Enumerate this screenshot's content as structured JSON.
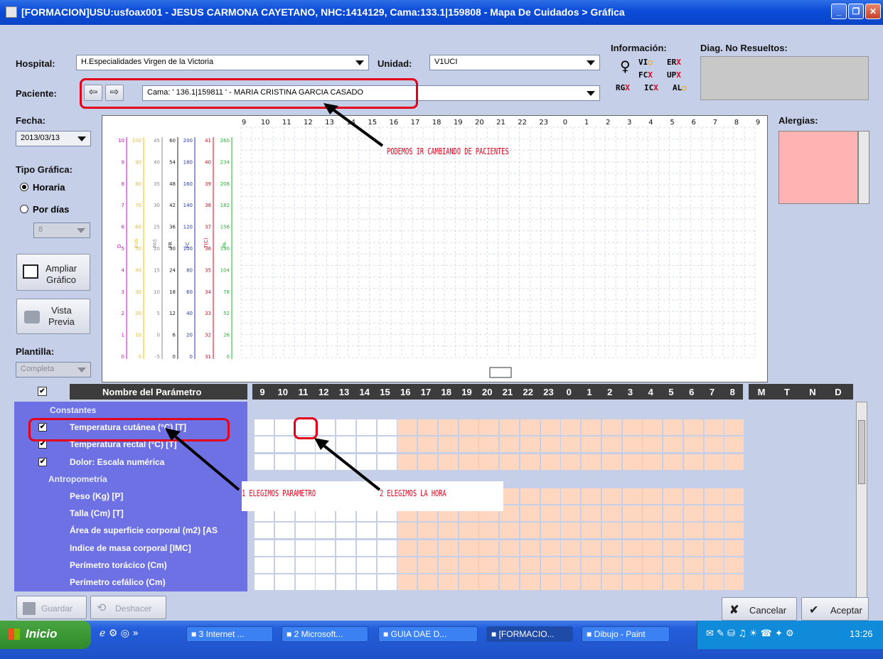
{
  "window": {
    "title": "[FORMACION]USU:usfoax001 - JESUS CARMONA CAYETANO, NHC:1414129, Cama:133.1|159808 - Mapa De Cuidados > Gráfica"
  },
  "form": {
    "hospital_label": "Hospital:",
    "hospital_value": "H.Especialidades Virgen de la Victoria",
    "unidad_label": "Unidad:",
    "unidad_value": "V1UCI",
    "paciente_label": "Paciente:",
    "paciente_value": "Cama: ' 136.1|159811 ' - MARIA CRISTINA GARCIA CASADO",
    "fecha_label": "Fecha:",
    "fecha_value": "2013/03/13",
    "tipo_label": "Tipo Gráfica:",
    "radio_horaria": "Horaria",
    "radio_dias": "Por días",
    "dias_value": "8",
    "plantilla_label": "Plantilla:",
    "plantilla_value": "Completa",
    "ampliar_line1": "Ampliar",
    "ampliar_line2": "Gráfico",
    "vista_line1": "Vista",
    "vista_line2": "Previa"
  },
  "info": {
    "label": "Información:",
    "diag_label": "Diag. No Resueltos:",
    "alergias_label": "Alergias:",
    "flags": [
      {
        "code": "VI",
        "mark": "○",
        "color": "#f0a000"
      },
      {
        "code": "ER",
        "mark": "X",
        "color": "#e3001b"
      },
      {
        "code": "FC",
        "mark": "X",
        "color": "#e3001b"
      },
      {
        "code": "UP",
        "mark": "X",
        "color": "#e3001b"
      },
      {
        "code": "RG",
        "mark": "X",
        "color": "#e3001b"
      },
      {
        "code": "IC",
        "mark": "X",
        "color": "#e3001b"
      },
      {
        "code": "AL",
        "mark": "○",
        "color": "#f0a000"
      }
    ]
  },
  "chart": {
    "hours": [
      "9",
      "10",
      "11",
      "12",
      "13",
      "14",
      "15",
      "16",
      "17",
      "18",
      "19",
      "20",
      "21",
      "22",
      "23",
      "0",
      "1",
      "2",
      "3",
      "4",
      "5",
      "6",
      "7",
      "8",
      "9"
    ],
    "scales": [
      {
        "color": "#e000e0",
        "name": "D",
        "ticks": [
          "10",
          "9",
          "8",
          "7",
          "6",
          "5",
          "4",
          "3",
          "2",
          "1",
          "0"
        ]
      },
      {
        "color": "#f5c000",
        "name": "EVA",
        "ticks": [
          "100",
          "90",
          "80",
          "70",
          "60",
          "50",
          "40",
          "30",
          "20",
          "10",
          "0"
        ]
      },
      {
        "color": "#8a8a8a",
        "name": "PAS",
        "ticks": [
          "45",
          "40",
          "35",
          "30",
          "25",
          "20",
          "15",
          "10",
          "5",
          "0",
          "-5"
        ]
      },
      {
        "color": "#222222",
        "name": "FR",
        "ticks": [
          "60",
          "54",
          "48",
          "42",
          "36",
          "30",
          "24",
          "18",
          "12",
          "6",
          "0"
        ]
      },
      {
        "color": "#2233dd",
        "name": "FC",
        "ticks": [
          "200",
          "180",
          "160",
          "140",
          "120",
          "100",
          "80",
          "60",
          "40",
          "20",
          "0"
        ]
      },
      {
        "color": "#e3001b",
        "name": "T(C)",
        "ticks": [
          "41",
          "40",
          "39",
          "38",
          "37",
          "36",
          "35",
          "34",
          "33",
          "32",
          "31"
        ]
      },
      {
        "color": "#10c020",
        "name": "PA",
        "ticks": [
          "260",
          "234",
          "208",
          "182",
          "156",
          "130",
          "104",
          "78",
          "52",
          "26",
          "0"
        ]
      }
    ]
  },
  "annotations": {
    "pacientes": "PODEMOS IR CAMBIANDO DE PACIENTES",
    "parametro": "1 ELEGIMOS PARAMETRO",
    "hora": "2 ELEGIMOS LA HORA"
  },
  "params": {
    "header_name": "Nombre del Parámetro",
    "hours": [
      "9",
      "10",
      "11",
      "12",
      "13",
      "14",
      "15",
      "16",
      "17",
      "18",
      "19",
      "20",
      "21",
      "22",
      "23",
      "0",
      "1",
      "2",
      "3",
      "4",
      "5",
      "6",
      "7",
      "8"
    ],
    "extra_cols": [
      "M",
      "T",
      "N",
      "D"
    ],
    "rows": [
      {
        "label": "Constantes",
        "kind": "group"
      },
      {
        "label": "Temperatura cutánea (°C) [T]",
        "kind": "check"
      },
      {
        "label": "Temperatura rectal (°C) [T]",
        "kind": "check"
      },
      {
        "label": "Dolor: Escala numérica",
        "kind": "check"
      },
      {
        "label": "Antropometría",
        "kind": "group"
      },
      {
        "label": "Peso (Kg) [P]",
        "kind": "item"
      },
      {
        "label": "Talla (Cm) [T]",
        "kind": "item"
      },
      {
        "label": "Área de superficie corporal (m2) [AS",
        "kind": "item"
      },
      {
        "label": "Indice de masa corporal [IMC]",
        "kind": "item"
      },
      {
        "label": "Perímetro torácico (Cm)",
        "kind": "item"
      },
      {
        "label": "Perímetro cefálico (Cm)",
        "kind": "item"
      }
    ]
  },
  "buttons": {
    "guardar": "Guardar",
    "deshacer": "Deshacer",
    "cancelar": "Cancelar",
    "aceptar": "Aceptar"
  },
  "taskbar": {
    "start": "Inicio",
    "items": [
      "3 Internet ...",
      "2 Microsoft...",
      "GUIA DAE D...",
      "[FORMACIO...",
      "Dibujo - Paint"
    ],
    "clock": "13:26"
  }
}
